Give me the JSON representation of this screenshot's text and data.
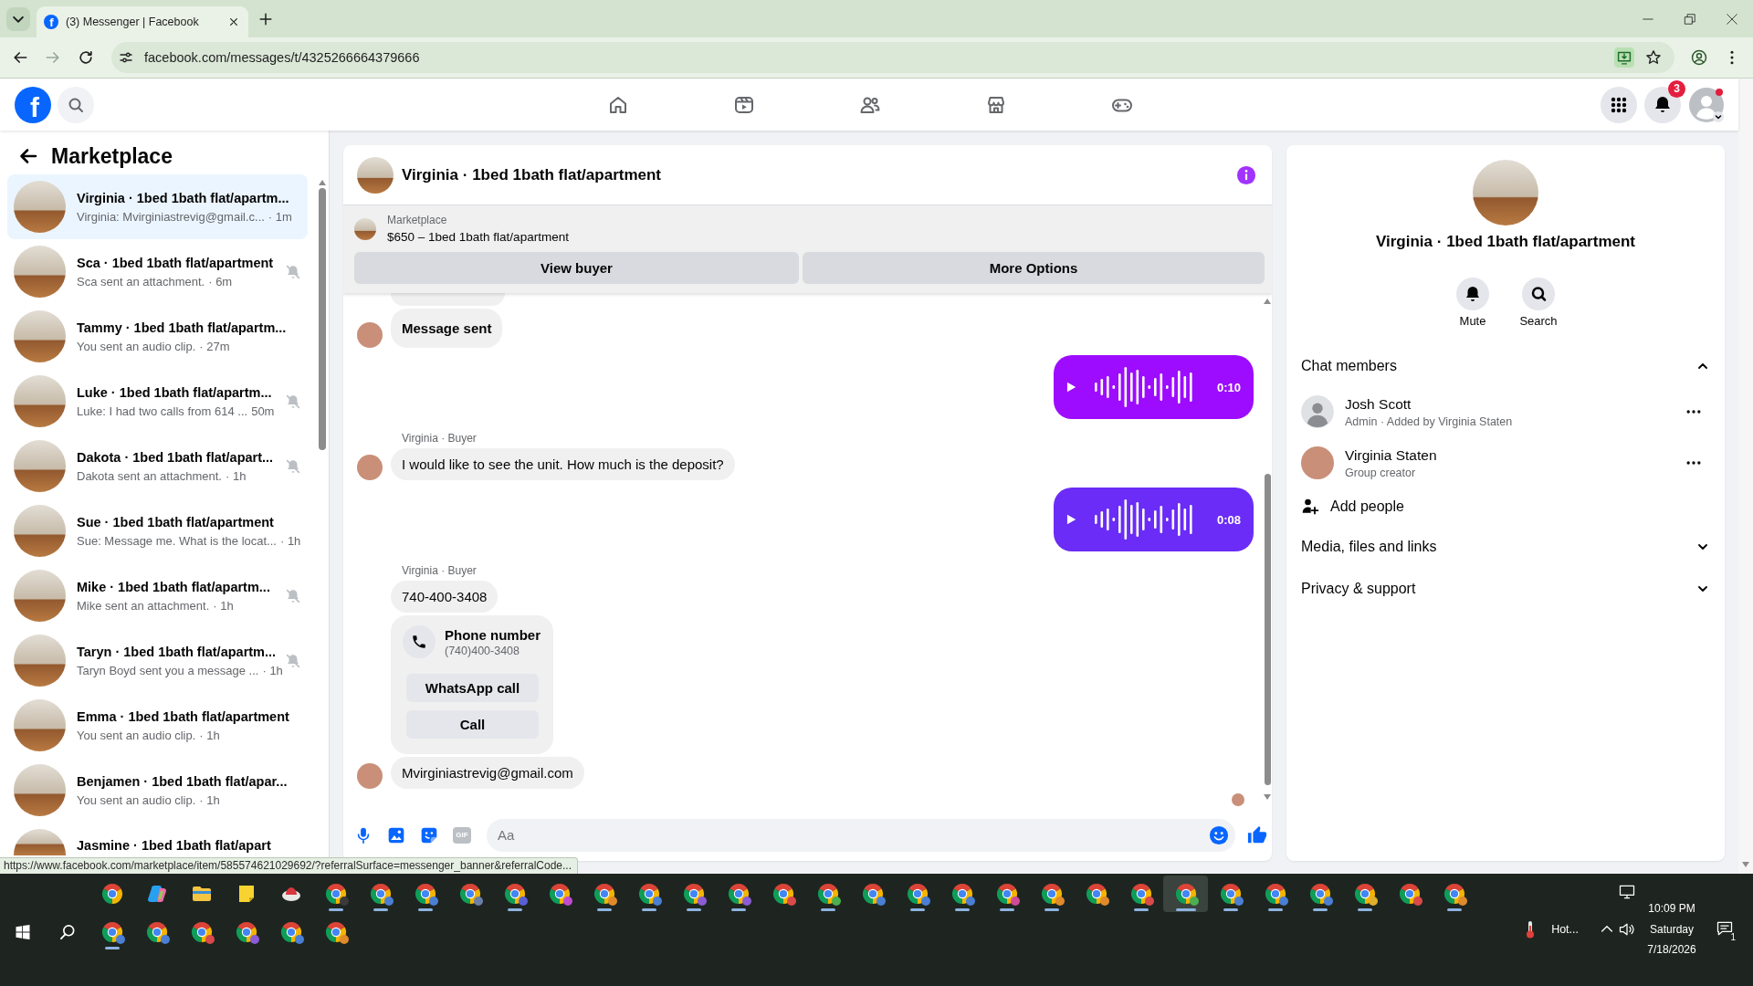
{
  "browser": {
    "tab_icon": "f",
    "tab_title": "(3) Messenger | Facebook",
    "url": "facebook.com/messages/t/4325266664379666",
    "status_url": "https://www.facebook.com/marketplace/item/585574621029692/?referralSurface=messenger_banner&referralCode..."
  },
  "header": {
    "logo": "f",
    "nav": [
      {
        "kind": "home",
        "selected": false
      },
      {
        "kind": "video",
        "selected": false
      },
      {
        "kind": "friends",
        "selected": false
      },
      {
        "kind": "marketplace",
        "selected": false
      },
      {
        "kind": "gaming",
        "selected": false
      }
    ],
    "notification_count": "3"
  },
  "sidebar": {
    "title": "Marketplace",
    "conversations": [
      {
        "kind": "full",
        "title": "Virginia · 1bed 1bath flat/apartm...",
        "preview": "Virginia: Mvirginiastrevig@gmail.c...",
        "time": "· 1m",
        "muted": false,
        "selected": true
      },
      {
        "kind": "full",
        "title": "Sca · 1bed 1bath flat/apartment",
        "preview": "Sca sent an attachment.",
        "time": "· 6m",
        "muted": true,
        "selected": false
      },
      {
        "kind": "full",
        "title": "Tammy · 1bed 1bath flat/apartm...",
        "preview": "You sent an audio clip.",
        "time": "· 27m",
        "muted": false,
        "selected": false
      },
      {
        "kind": "full",
        "title": "Luke · 1bed 1bath flat/apartm...",
        "preview": "Luke: I had two calls from 614 ...",
        "time": "50m",
        "muted": true,
        "selected": false
      },
      {
        "kind": "full",
        "title": "Dakota · 1bed 1bath flat/apart...",
        "preview": "Dakota sent an attachment.",
        "time": "· 1h",
        "muted": true,
        "selected": false
      },
      {
        "kind": "full",
        "title": "Sue · 1bed 1bath flat/apartment",
        "preview": "Sue: Message me. What is the locat...",
        "time": "· 1h",
        "muted": false,
        "selected": false
      },
      {
        "kind": "full",
        "title": "Mike · 1bed 1bath flat/apartm...",
        "preview": "Mike sent an attachment.",
        "time": "· 1h",
        "muted": true,
        "selected": false
      },
      {
        "kind": "full",
        "title": "Taryn · 1bed 1bath flat/apartm...",
        "preview": "Taryn Boyd sent you a message ...",
        "time": "· 1h",
        "muted": true,
        "selected": false
      },
      {
        "kind": "full",
        "title": "Emma · 1bed 1bath flat/apartment",
        "preview": "You sent an audio clip.",
        "time": "· 1h",
        "muted": false,
        "selected": false
      },
      {
        "kind": "full",
        "title": "Benjamen · 1bed 1bath flat/apar...",
        "preview": "You sent an audio clip.",
        "time": "· 1h",
        "muted": false,
        "selected": false
      },
      {
        "kind": "partial",
        "title": "Jasmine · 1bed 1bath flat/apart",
        "muted": false,
        "selected": false
      }
    ]
  },
  "chat": {
    "title": "Virginia · 1bed 1bath flat/apartment",
    "listing": {
      "label": "Marketplace",
      "title": "$650 – 1bed 1bath flat/apartment"
    },
    "actions": [
      "View buyer",
      "More Options"
    ],
    "messages": [
      {
        "kind": "cut_off"
      },
      {
        "kind": "notice",
        "text": "Message sent",
        "show_avatar": true
      },
      {
        "kind": "audio",
        "duration": "0:10",
        "color": "#9d0cff"
      },
      {
        "kind": "sender",
        "text": "Virginia · Buyer"
      },
      {
        "kind": "text",
        "text": "I would like to see the unit. How much is the deposit?",
        "show_avatar": true
      },
      {
        "kind": "audio",
        "duration": "0:08",
        "color": "#6a2cf6"
      },
      {
        "kind": "sender",
        "text": "Virginia · Buyer"
      },
      {
        "kind": "text",
        "text": "740-400-3408",
        "show_avatar": false
      },
      {
        "kind": "phone_card",
        "title": "Phone number",
        "number": "(740)400-3408",
        "buttons": [
          "WhatsApp call",
          "Call"
        ],
        "show_avatar": false
      },
      {
        "kind": "text",
        "text": "Mvirginiastrevig@gmail.com",
        "show_avatar": true
      },
      {
        "kind": "seen"
      }
    ],
    "composer": {
      "gif": "GIF",
      "placeholder": "Aa"
    }
  },
  "details": {
    "title": "Virginia · 1bed 1bath flat/apartment",
    "actions": [
      {
        "kind": "mute",
        "label": "Mute"
      },
      {
        "kind": "search",
        "label": "Search"
      }
    ],
    "sections": [
      {
        "title": "Chat members",
        "expanded": true,
        "members": [
          {
            "kind": "silhouette",
            "name": "Josh Scott",
            "role": "Admin · Added by Virginia Staten"
          },
          {
            "kind": "photo",
            "name": "Virginia Staten",
            "role": "Group creator"
          }
        ],
        "add_label": "Add people"
      },
      {
        "title": "Media, files and links",
        "expanded": false
      },
      {
        "title": "Privacy & support",
        "expanded": false
      }
    ]
  },
  "taskbar": {
    "row_1": [
      {
        "kind": "chrome",
        "running": false,
        "active": false
      },
      {
        "kind": "copilot",
        "running": false,
        "active": false
      },
      {
        "kind": "explorer",
        "running": false,
        "active": false
      },
      {
        "kind": "notes",
        "running": false,
        "active": false
      },
      {
        "kind": "app",
        "running": false,
        "active": false
      },
      {
        "kind": "chrome",
        "color": "#3a3a3a",
        "running": true,
        "active": false
      },
      {
        "kind": "chrome",
        "color": "#4a7fd4",
        "running": true,
        "active": false
      },
      {
        "kind": "chrome",
        "color": "#4a7fd4",
        "running": true,
        "active": false
      },
      {
        "kind": "chrome",
        "color": "#6b7fa8",
        "running": false,
        "active": false
      },
      {
        "kind": "chrome",
        "color": "#5b5fd6",
        "running": true,
        "active": false
      },
      {
        "kind": "chrome",
        "color": "#c04ad0",
        "running": false,
        "active": false
      },
      {
        "kind": "chrome",
        "color": "#e08a2c",
        "running": true,
        "active": false
      },
      {
        "kind": "chrome",
        "color": "#4a7fd4",
        "running": true,
        "active": false
      },
      {
        "kind": "chrome",
        "color": "#8b5cd6",
        "running": true,
        "active": false
      },
      {
        "kind": "chrome",
        "color": "#8b5cd6",
        "running": true,
        "active": false
      },
      {
        "kind": "chrome",
        "color": "#d94a4a",
        "running": false,
        "active": false
      },
      {
        "kind": "chrome",
        "color": "#4caf50",
        "running": true,
        "active": false
      },
      {
        "kind": "chrome",
        "color": "#4a7fd4",
        "running": false,
        "active": false
      },
      {
        "kind": "chrome",
        "color": "#4a7fd4",
        "running": true,
        "active": false
      },
      {
        "kind": "chrome",
        "color": "#4a7fd4",
        "running": true,
        "active": false
      },
      {
        "kind": "chrome",
        "color": "#d04a9a",
        "running": true,
        "active": false
      },
      {
        "kind": "chrome",
        "color": "#e08a2c",
        "running": true,
        "active": false
      },
      {
        "kind": "chrome",
        "color": "#e08a2c",
        "running": false,
        "active": false
      },
      {
        "kind": "chrome",
        "color": "#d94a4a",
        "running": true,
        "active": false
      },
      {
        "kind": "chrome",
        "color": "#4caf50",
        "running": true,
        "active": true
      },
      {
        "kind": "chrome",
        "color": "#4a7fd4",
        "running": true,
        "active": false
      },
      {
        "kind": "chrome",
        "color": "#4a7fd4",
        "running": true,
        "active": false
      },
      {
        "kind": "chrome",
        "color": "#4a7fd4",
        "running": true,
        "active": false
      },
      {
        "kind": "chrome",
        "color": "#e0b02c",
        "running": true,
        "active": false
      },
      {
        "kind": "chrome",
        "color": "#d94a4a",
        "running": false,
        "active": false
      },
      {
        "kind": "chrome",
        "color": "#e08a2c",
        "running": true,
        "active": false
      }
    ],
    "row_2": [
      {
        "kind": "chrome",
        "color": "#4a7fd4",
        "running": true,
        "active": false
      },
      {
        "kind": "chrome",
        "color": "#4a7fd4",
        "running": false,
        "active": false
      },
      {
        "kind": "chrome",
        "color": "#d94a4a",
        "running": false,
        "active": false
      },
      {
        "kind": "chrome",
        "color": "#8b5cd6",
        "running": false,
        "active": false
      },
      {
        "kind": "chrome",
        "color": "#4a7fd4",
        "running": false,
        "active": false
      },
      {
        "kind": "chrome",
        "color": "#e08a2c",
        "running": false,
        "active": false
      }
    ],
    "tray": {
      "weather": "Hot...",
      "time": "10:09 PM",
      "day": "Saturday",
      "date": "7/18/2026",
      "notification_count": "1"
    }
  }
}
